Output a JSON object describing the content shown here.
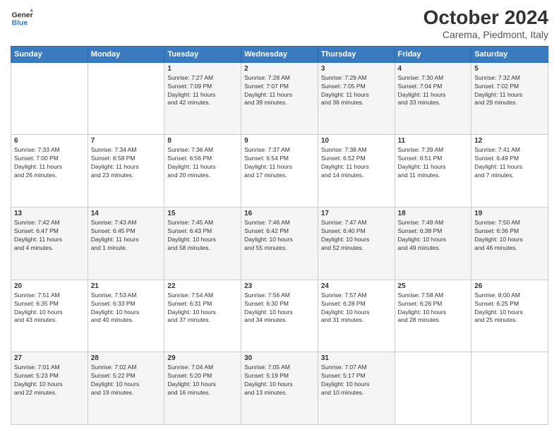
{
  "logo": {
    "line1": "General",
    "line2": "Blue"
  },
  "title": "October 2024",
  "subtitle": "Carema, Piedmont, Italy",
  "days_header": [
    "Sunday",
    "Monday",
    "Tuesday",
    "Wednesday",
    "Thursday",
    "Friday",
    "Saturday"
  ],
  "weeks": [
    [
      {
        "day": "",
        "info": ""
      },
      {
        "day": "",
        "info": ""
      },
      {
        "day": "1",
        "info": "Sunrise: 7:27 AM\nSunset: 7:09 PM\nDaylight: 11 hours\nand 42 minutes."
      },
      {
        "day": "2",
        "info": "Sunrise: 7:28 AM\nSunset: 7:07 PM\nDaylight: 11 hours\nand 39 minutes."
      },
      {
        "day": "3",
        "info": "Sunrise: 7:29 AM\nSunset: 7:05 PM\nDaylight: 11 hours\nand 36 minutes."
      },
      {
        "day": "4",
        "info": "Sunrise: 7:30 AM\nSunset: 7:04 PM\nDaylight: 11 hours\nand 33 minutes."
      },
      {
        "day": "5",
        "info": "Sunrise: 7:32 AM\nSunset: 7:02 PM\nDaylight: 11 hours\nand 29 minutes."
      }
    ],
    [
      {
        "day": "6",
        "info": "Sunrise: 7:33 AM\nSunset: 7:00 PM\nDaylight: 11 hours\nand 26 minutes."
      },
      {
        "day": "7",
        "info": "Sunrise: 7:34 AM\nSunset: 6:58 PM\nDaylight: 11 hours\nand 23 minutes."
      },
      {
        "day": "8",
        "info": "Sunrise: 7:36 AM\nSunset: 6:56 PM\nDaylight: 11 hours\nand 20 minutes."
      },
      {
        "day": "9",
        "info": "Sunrise: 7:37 AM\nSunset: 6:54 PM\nDaylight: 11 hours\nand 17 minutes."
      },
      {
        "day": "10",
        "info": "Sunrise: 7:38 AM\nSunset: 6:52 PM\nDaylight: 11 hours\nand 14 minutes."
      },
      {
        "day": "11",
        "info": "Sunrise: 7:39 AM\nSunset: 6:51 PM\nDaylight: 11 hours\nand 11 minutes."
      },
      {
        "day": "12",
        "info": "Sunrise: 7:41 AM\nSunset: 6:49 PM\nDaylight: 11 hours\nand 7 minutes."
      }
    ],
    [
      {
        "day": "13",
        "info": "Sunrise: 7:42 AM\nSunset: 6:47 PM\nDaylight: 11 hours\nand 4 minutes."
      },
      {
        "day": "14",
        "info": "Sunrise: 7:43 AM\nSunset: 6:45 PM\nDaylight: 11 hours\nand 1 minute."
      },
      {
        "day": "15",
        "info": "Sunrise: 7:45 AM\nSunset: 6:43 PM\nDaylight: 10 hours\nand 58 minutes."
      },
      {
        "day": "16",
        "info": "Sunrise: 7:46 AM\nSunset: 6:42 PM\nDaylight: 10 hours\nand 55 minutes."
      },
      {
        "day": "17",
        "info": "Sunrise: 7:47 AM\nSunset: 6:40 PM\nDaylight: 10 hours\nand 52 minutes."
      },
      {
        "day": "18",
        "info": "Sunrise: 7:49 AM\nSunset: 6:38 PM\nDaylight: 10 hours\nand 49 minutes."
      },
      {
        "day": "19",
        "info": "Sunrise: 7:50 AM\nSunset: 6:36 PM\nDaylight: 10 hours\nand 46 minutes."
      }
    ],
    [
      {
        "day": "20",
        "info": "Sunrise: 7:51 AM\nSunset: 6:35 PM\nDaylight: 10 hours\nand 43 minutes."
      },
      {
        "day": "21",
        "info": "Sunrise: 7:53 AM\nSunset: 6:33 PM\nDaylight: 10 hours\nand 40 minutes."
      },
      {
        "day": "22",
        "info": "Sunrise: 7:54 AM\nSunset: 6:31 PM\nDaylight: 10 hours\nand 37 minutes."
      },
      {
        "day": "23",
        "info": "Sunrise: 7:56 AM\nSunset: 6:30 PM\nDaylight: 10 hours\nand 34 minutes."
      },
      {
        "day": "24",
        "info": "Sunrise: 7:57 AM\nSunset: 6:28 PM\nDaylight: 10 hours\nand 31 minutes."
      },
      {
        "day": "25",
        "info": "Sunrise: 7:58 AM\nSunset: 6:26 PM\nDaylight: 10 hours\nand 28 minutes."
      },
      {
        "day": "26",
        "info": "Sunrise: 8:00 AM\nSunset: 6:25 PM\nDaylight: 10 hours\nand 25 minutes."
      }
    ],
    [
      {
        "day": "27",
        "info": "Sunrise: 7:01 AM\nSunset: 5:23 PM\nDaylight: 10 hours\nand 22 minutes."
      },
      {
        "day": "28",
        "info": "Sunrise: 7:02 AM\nSunset: 5:22 PM\nDaylight: 10 hours\nand 19 minutes."
      },
      {
        "day": "29",
        "info": "Sunrise: 7:04 AM\nSunset: 5:20 PM\nDaylight: 10 hours\nand 16 minutes."
      },
      {
        "day": "30",
        "info": "Sunrise: 7:05 AM\nSunset: 5:19 PM\nDaylight: 10 hours\nand 13 minutes."
      },
      {
        "day": "31",
        "info": "Sunrise: 7:07 AM\nSunset: 5:17 PM\nDaylight: 10 hours\nand 10 minutes."
      },
      {
        "day": "",
        "info": ""
      },
      {
        "day": "",
        "info": ""
      }
    ]
  ]
}
